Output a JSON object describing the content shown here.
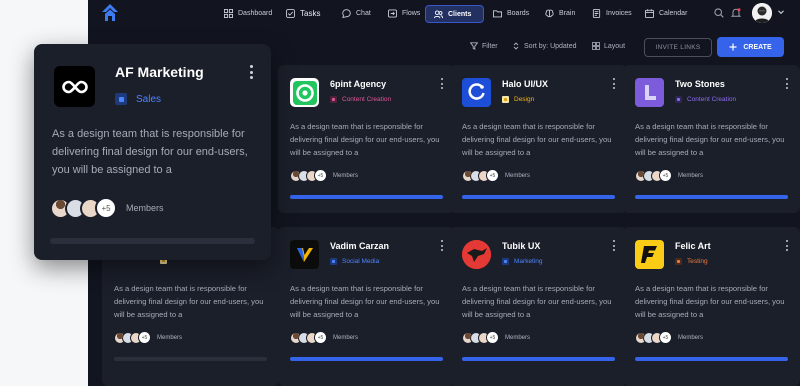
{
  "nav": {
    "items": [
      {
        "label": "Dashboard",
        "icon": "grid-icon"
      },
      {
        "label": "Tasks",
        "icon": "check-square-icon"
      },
      {
        "label": "Chat",
        "icon": "chat-icon"
      },
      {
        "label": "Flows",
        "icon": "flows-icon"
      },
      {
        "label": "Clients",
        "icon": "users-icon",
        "active": true
      },
      {
        "label": "Boards",
        "icon": "folder-icon"
      },
      {
        "label": "Brain",
        "icon": "brain-icon"
      },
      {
        "label": "Invoices",
        "icon": "invoice-icon"
      },
      {
        "label": "Calendar",
        "icon": "calendar-icon"
      }
    ]
  },
  "toolbar": {
    "filter": "Filter",
    "sort": "Sort by: Updated",
    "layout": "Layout",
    "invite": "INVITE LINKS",
    "create": "CREATE"
  },
  "members_label": "Members",
  "members_more": "+5",
  "featured": {
    "name": "AF Marketing",
    "tag": "Sales",
    "desc": "As a design team that is responsible for delivering final design for our end-users, you will be assigned to a",
    "members_label": "Members",
    "members_more": "+5"
  },
  "cards": [
    {
      "name": "6pint Agency",
      "tag": "Content Creation",
      "tag_color": "#e0559a",
      "desc": "As a design team that is responsible for delivering final design for our end-users, you will be assigned to a"
    },
    {
      "name": "Halo UI/UX",
      "tag": "Design",
      "tag_color": "#f2b416",
      "desc": "As a design team that is responsible for delivering final design for our end-users, you will be assigned to a"
    },
    {
      "name": "Two Stones",
      "tag": "Content Creation",
      "tag_color": "#8b6cf0",
      "desc": "As a design team that is responsible for delivering final design for our end-users, you will be assigned to a"
    },
    {
      "name": "",
      "tag": "",
      "tag_color": "#f2b416",
      "desc": "As a design team that is responsible for delivering final design for our end-users, you will be assigned to a"
    },
    {
      "name": "Vadim Carzan",
      "tag": "Social Media",
      "tag_color": "#4d84ff",
      "desc": "As a design team that is responsible for delivering final design for our end-users, you will be assigned to a"
    },
    {
      "name": "Tubik UX",
      "tag": "Marketing",
      "tag_color": "#4d84ff",
      "desc": "As a design team that is responsible for delivering final design for our end-users, you will be assigned to a"
    },
    {
      "name": "Felic Art",
      "tag": "Testing",
      "tag_color": "#f07a3c",
      "desc": "As a design team that is responsible for delivering final design for our end-users, you will be assigned to a"
    }
  ]
}
